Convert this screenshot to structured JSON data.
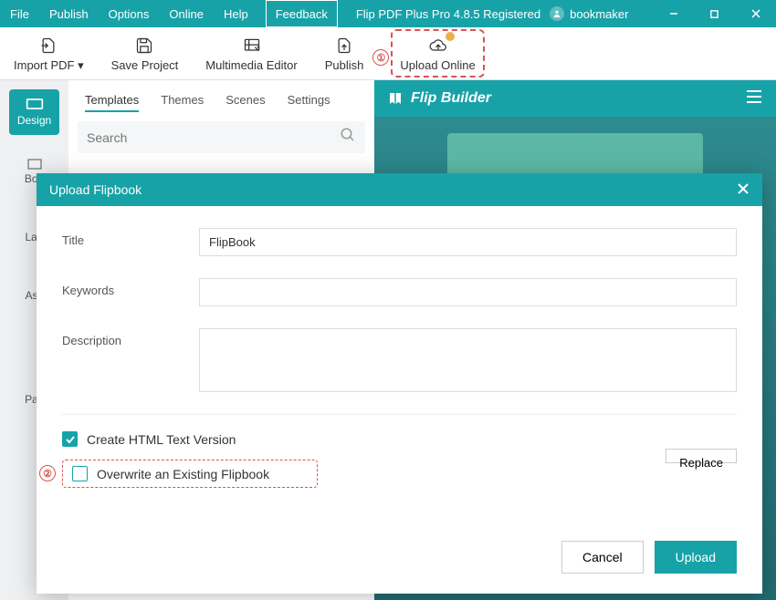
{
  "titlebar": {
    "menus": [
      "File",
      "Publish",
      "Options",
      "Online",
      "Help"
    ],
    "feedback": "Feedback",
    "app_title": "Flip PDF Plus Pro 4.8.5 Registered",
    "user": "bookmaker"
  },
  "toolbar": {
    "import_pdf": "Import PDF ▾",
    "save_project": "Save Project",
    "multimedia_editor": "Multimedia Editor",
    "publish": "Publish",
    "upload_online": "Upload Online"
  },
  "callouts": {
    "one": "①",
    "two": "②"
  },
  "sidebar": {
    "design": "Design",
    "items": [
      "Boo",
      "Lan",
      "Ass",
      "Pas"
    ]
  },
  "tabs": {
    "templates": "Templates",
    "themes": "Themes",
    "scenes": "Scenes",
    "settings": "Settings"
  },
  "search": {
    "placeholder": "Search"
  },
  "preview": {
    "brand": "Flip Builder"
  },
  "dialog": {
    "title": "Upload Flipbook",
    "labels": {
      "title": "Title",
      "keywords": "Keywords",
      "description": "Description"
    },
    "values": {
      "title": "FlipBook",
      "keywords": "",
      "description": ""
    },
    "create_html": "Create HTML Text Version",
    "overwrite": "Overwrite an Existing Flipbook",
    "replace": "Replace",
    "cancel": "Cancel",
    "upload": "Upload"
  }
}
